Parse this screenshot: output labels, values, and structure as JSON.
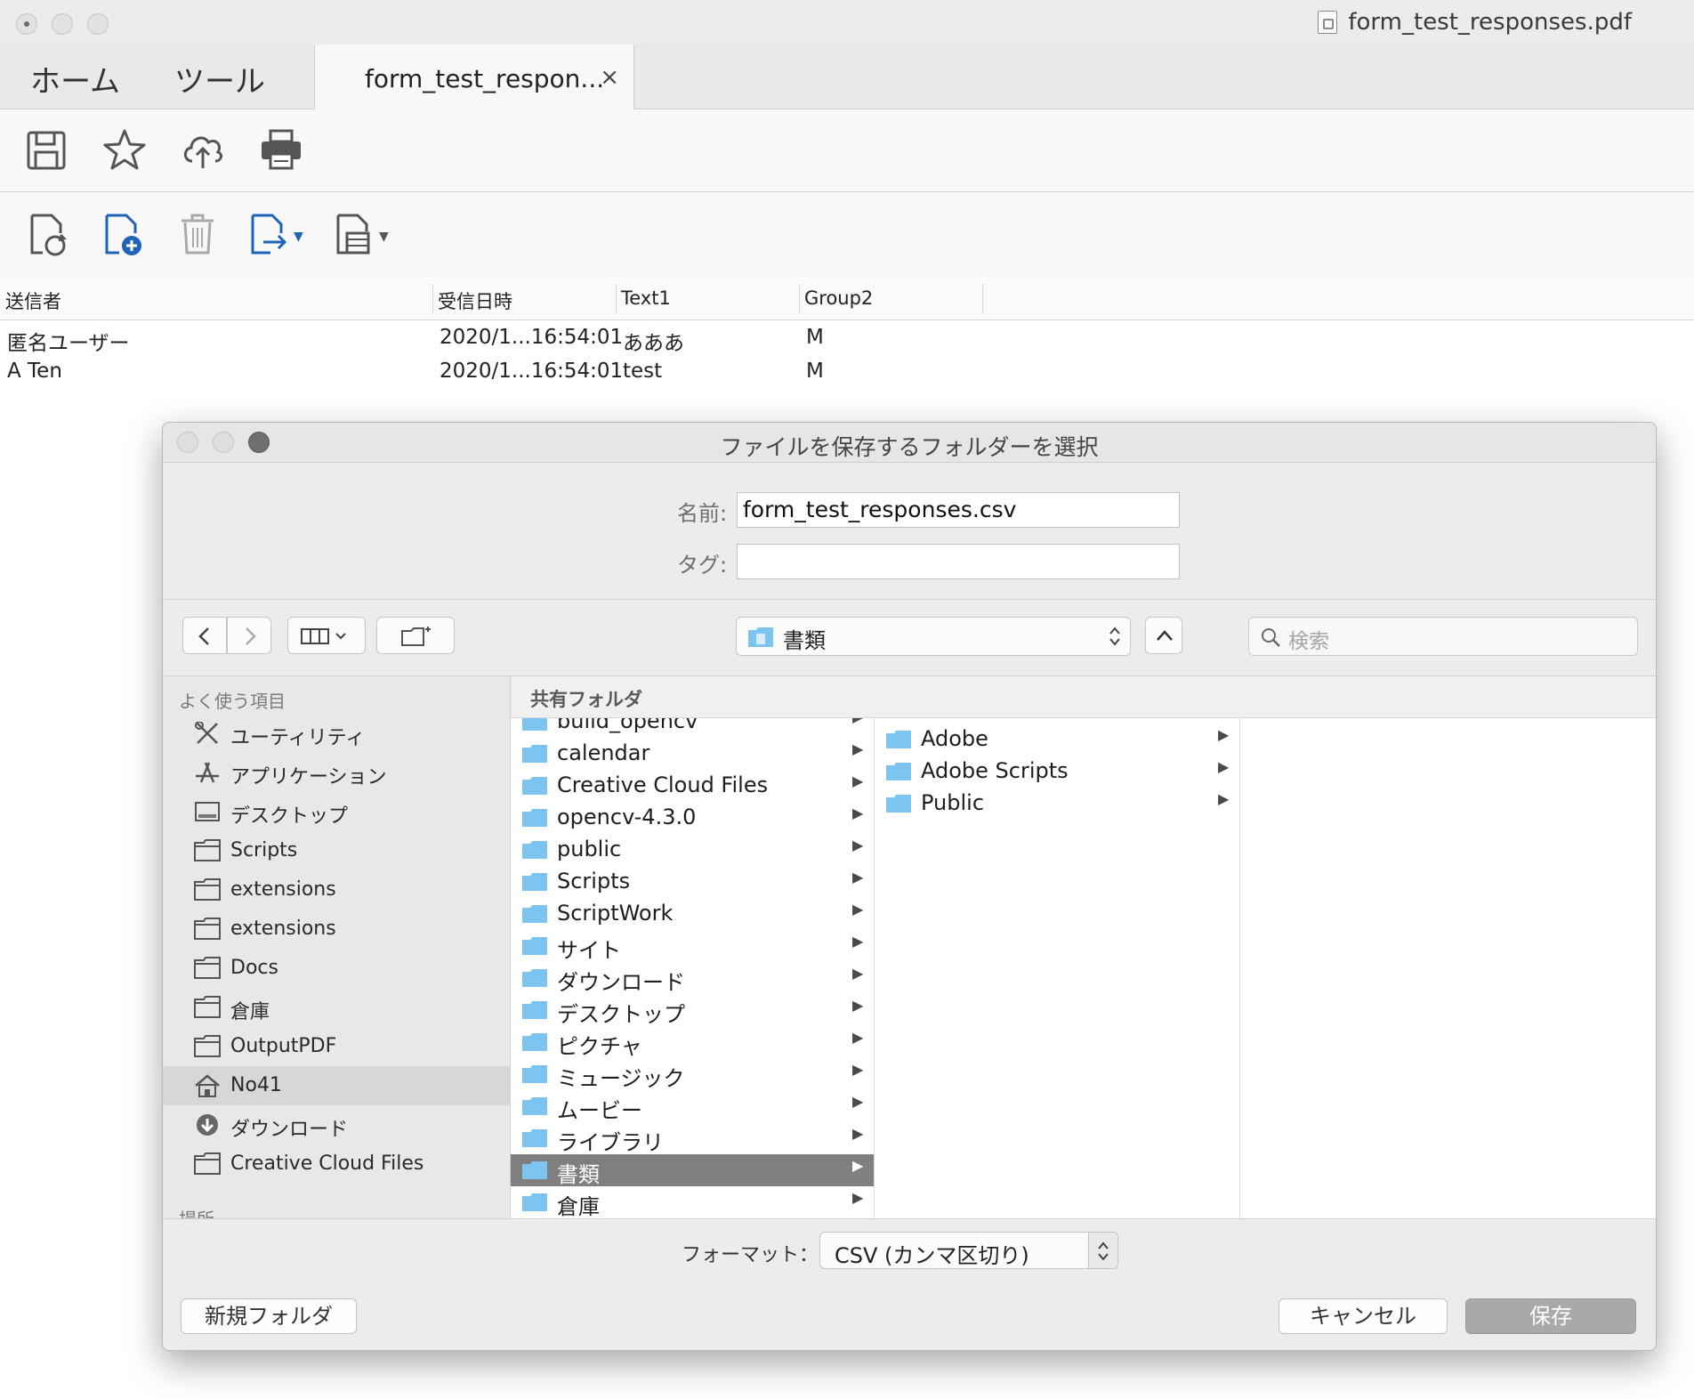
{
  "window": {
    "title": "form_test_responses.pdf"
  },
  "tabs": {
    "home": "ホーム",
    "tools": "ツール",
    "document": "form_test_respon...",
    "close": "×"
  },
  "toolbar": {
    "top_icons": [
      "save-icon",
      "star-icon",
      "cloud-upload-icon",
      "print-icon"
    ],
    "bottom_icons": [
      "refresh-document-icon",
      "add-document-icon",
      "trash-icon",
      "export-document-icon",
      "document-options-icon"
    ]
  },
  "grid": {
    "headers": [
      "送信者",
      "受信日時",
      "Text1",
      "Group2"
    ],
    "rows": [
      [
        "匿名ユーザー",
        "2020/1...16:54:01",
        "あああ",
        "M"
      ],
      [
        "A Ten",
        "2020/1...16:54:01",
        "test",
        "M"
      ]
    ]
  },
  "dialog": {
    "title": "ファイルを保存するフォルダーを選択",
    "name_label": "名前:",
    "name_value": "form_test_responses.csv",
    "tags_label": "タグ:",
    "tags_value": "",
    "current_folder": "書類",
    "search_placeholder": "検索",
    "sidebar": {
      "favorites_heading": "よく使う項目",
      "items": [
        {
          "label": "ユーティリティ",
          "icon": "utilities-icon"
        },
        {
          "label": "アプリケーション",
          "icon": "applications-icon"
        },
        {
          "label": "デスクトップ",
          "icon": "desktop-icon"
        },
        {
          "label": "Scripts",
          "icon": "folder-icon"
        },
        {
          "label": "extensions",
          "icon": "folder-icon"
        },
        {
          "label": "extensions",
          "icon": "folder-icon"
        },
        {
          "label": "Docs",
          "icon": "folder-icon"
        },
        {
          "label": "倉庫",
          "icon": "folder-icon"
        },
        {
          "label": "OutputPDF",
          "icon": "folder-icon"
        },
        {
          "label": "No41",
          "icon": "home-icon",
          "selected": true
        },
        {
          "label": "ダウンロード",
          "icon": "downloads-icon"
        },
        {
          "label": "Creative Cloud Files",
          "icon": "folder-icon"
        }
      ],
      "locations_heading": "場所"
    },
    "column_header": "共有フォルダ",
    "column1": [
      "build_opencv",
      "calendar",
      "Creative Cloud Files",
      "opencv-4.3.0",
      "public",
      "Scripts",
      "ScriptWork",
      "サイト",
      "ダウンロード",
      "デスクトップ",
      "ピクチャ",
      "ミュージック",
      "ムービー",
      "ライブラリ",
      "書類",
      "倉庫"
    ],
    "column1_selected": "書類",
    "column2": [
      "Adobe",
      "Adobe Scripts",
      "Public"
    ],
    "format_label": "フォーマット：",
    "format_value": "CSV (カンマ区切り)",
    "new_folder": "新規フォルダ",
    "cancel": "キャンセル",
    "save": "保存"
  },
  "colors": {
    "folder_blue": "#7ec4f1",
    "selection_gray": "#7f7f7f",
    "accent_blue": "#1d63b6"
  }
}
